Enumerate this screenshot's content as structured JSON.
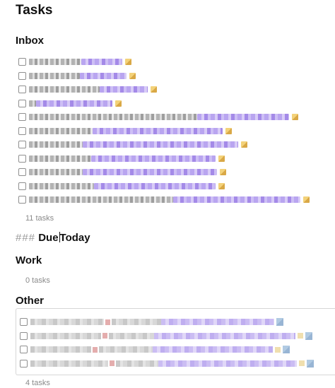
{
  "page": {
    "title": "Tasks"
  },
  "inbox": {
    "heading": "Inbox",
    "count_label": "11 tasks",
    "tasks": [
      {
        "checked": false,
        "text_width": 74,
        "link_width": 58
      },
      {
        "checked": false,
        "text_width": 72,
        "link_width": 66
      },
      {
        "checked": false,
        "text_width": 100,
        "link_width": 68
      },
      {
        "checked": false,
        "text_width": 10,
        "link_width": 108
      },
      {
        "checked": false,
        "text_width": 238,
        "link_width": 130
      },
      {
        "checked": false,
        "text_width": 90,
        "link_width": 184
      },
      {
        "checked": false,
        "text_width": 76,
        "link_width": 220
      },
      {
        "checked": false,
        "text_width": 88,
        "link_width": 176
      },
      {
        "checked": false,
        "text_width": 76,
        "link_width": 190
      },
      {
        "checked": false,
        "text_width": 92,
        "link_width": 172
      },
      {
        "checked": false,
        "text_width": 204,
        "link_width": 190
      }
    ],
    "edit_icon": "pencil-edit-icon"
  },
  "due_today": {
    "markdown_hashes": "###",
    "word1": "Due",
    "word2": "Today"
  },
  "work": {
    "heading": "Work",
    "count_label": "0 tasks"
  },
  "other": {
    "heading": "Other",
    "count_label": "4 tasks",
    "tasks": [
      {
        "checked": false,
        "text_width": 180,
        "link_width": 164
      },
      {
        "checked": false,
        "text_width": 168,
        "link_width": 216
      },
      {
        "checked": false,
        "text_width": 164,
        "link_width": 180
      },
      {
        "checked": false,
        "text_width": 176,
        "link_width": 216
      }
    ]
  },
  "colors": {
    "link_tint": "#b9a5f0",
    "muted_text": "#8a8a8a"
  }
}
